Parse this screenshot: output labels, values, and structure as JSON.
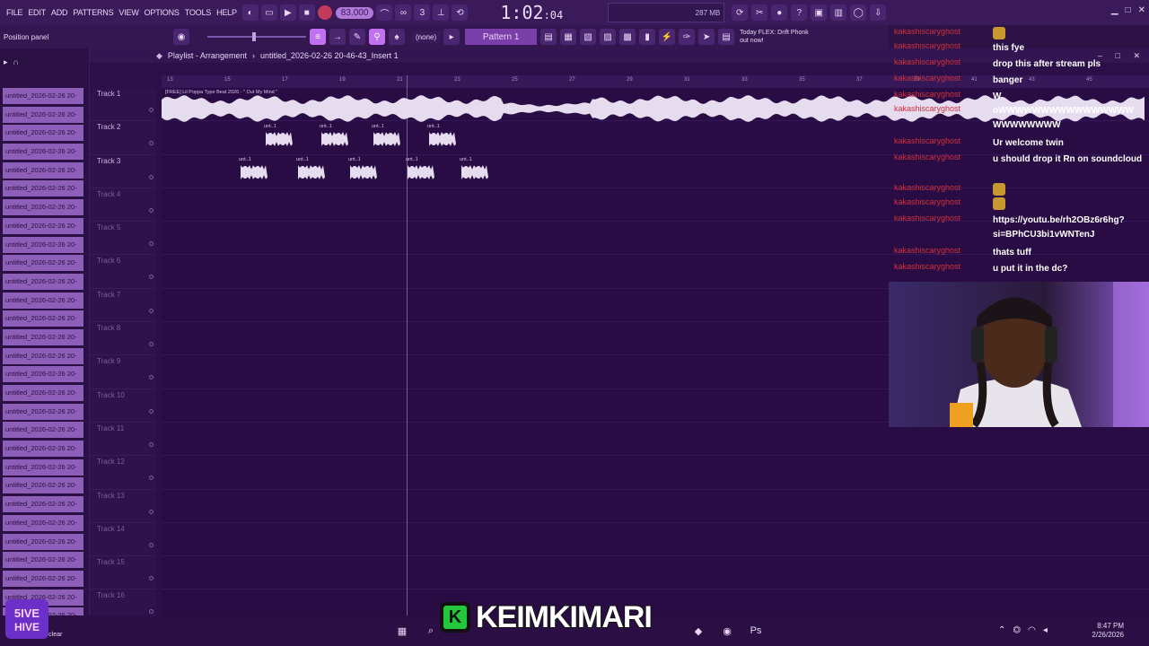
{
  "menu": [
    "FILE",
    "EDIT",
    "ADD",
    "PATTERNS",
    "VIEW",
    "OPTIONS",
    "TOOLS",
    "HELP"
  ],
  "toolbar": {
    "tempo": "83.000",
    "time_main": "1:02",
    "time_sub": ":04",
    "cpu_label": "287 MB",
    "cpu_value": "0"
  },
  "row2": {
    "hint": "Position panel",
    "pattern_selector": "(none)",
    "pattern_name": "Pattern 1",
    "news_line1": "Today  FLEX: Drift Phonk",
    "news_line2": "out now!"
  },
  "playlist": {
    "title": "Playlist - Arrangement",
    "breadcrumb": "untitled_2026-02-26 20-46-43_Insert 1",
    "tracks": [
      "Track 1",
      "Track 2",
      "Track 3",
      "Track 4",
      "Track 5",
      "Track 6",
      "Track 7",
      "Track 8",
      "Track 9",
      "Track 10",
      "Track 11",
      "Track 12",
      "Track 13",
      "Track 14",
      "Track 15",
      "Track 16"
    ],
    "ruler": [
      "13",
      "15",
      "17",
      "19",
      "21",
      "23",
      "25",
      "27",
      "29",
      "31",
      "33",
      "35",
      "37",
      "39",
      "41",
      "43",
      "45"
    ],
    "track1_clip": "[FREE] Lil Poppa Type Beat 2026 - \" Out My Mind \"",
    "small_clip": "unt..1"
  },
  "browser": {
    "items": [
      "untitled_2026-02-26 20-",
      "untitled_2026-02-26 20-",
      "untitled_2026-02-26 20-",
      "untitled_2026-02-26 20-",
      "untitled_2026-02-26 20-",
      "untitled_2026-02-26 20-",
      "untitled_2026-02-26 20-",
      "untitled_2026-02-26 20-",
      "untitled_2026-02-26 20-",
      "untitled_2026-02-26 20-",
      "untitled_2026-02-26 20-",
      "untitled_2026-02-26 20-",
      "untitled_2026-02-26 20-",
      "untitled_2026-02-26 20-",
      "untitled_2026-02-26 20-",
      "untitled_2026-02-26 20-",
      "untitled_2026-02-26 20-",
      "untitled_2026-02-26 20-",
      "untitled_2026-02-26 20-",
      "untitled_2026-02-26 20-",
      "untitled_2026-02-26 20-",
      "untitled_2026-02-26 20-",
      "untitled_2026-02-26 20-",
      "untitled_2026-02-26 20-",
      "untitled_2026-02-26 20-",
      "untitled_2026-02-26 20-",
      "untitled_2026-02-26 20-",
      "untitled_2026-02-26 20-",
      "untitled_2026-02-26 20-",
      "untitled_2026-02-26 20-"
    ]
  },
  "chat": [
    {
      "user": "kakashiscaryghost",
      "text": "",
      "emote": true
    },
    {
      "user": "kakashiscaryghost",
      "text": "this fye"
    },
    {
      "user": "kakashiscaryghost",
      "text": "drop this after stream pls"
    },
    {
      "user": "kakashiscaryghost",
      "text": "banger"
    },
    {
      "user": "kakashiscaryghost",
      "text": "W"
    },
    {
      "user": "kakashiscaryghost",
      "text": "oWWWWWWWWWWWWWWWW WWWWWWWW"
    },
    {
      "user": "kakashiscaryghost",
      "text": "Ur welcome twin"
    },
    {
      "user": "kakashiscaryghost",
      "text": "u should drop it Rn on soundcloud"
    },
    {
      "user": "kakashiscaryghost",
      "text": "",
      "emote": true
    },
    {
      "user": "kakashiscaryghost",
      "text": "",
      "emote": true
    },
    {
      "user": "kakashiscaryghost",
      "text": "https://youtu.be/rh2OBz6r6hg?si=BPhCU3bi1vWNTenJ"
    },
    {
      "user": "kakashiscaryghost",
      "text": "thats tuff"
    },
    {
      "user": "kakashiscaryghost",
      "text": "u put it in the dc?"
    }
  ],
  "overlay": {
    "brand_text": "KEIMKIMARI",
    "brand_initial": "K",
    "weather": "Mostly clear",
    "time": "8:47 PM",
    "date": "2/26/2026"
  },
  "colors": {
    "accent": "#c070f0",
    "chat_user": "#d0303a",
    "brand_green": "#22c83a"
  }
}
